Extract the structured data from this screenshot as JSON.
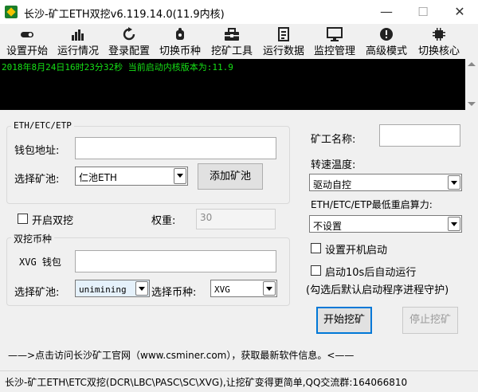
{
  "window": {
    "title": "长沙-矿工ETH双挖v6.119.14.0(11.9内核)",
    "minimize": "—",
    "maximize": "☐",
    "close": "✕"
  },
  "toolbar": {
    "items": [
      {
        "label": "设置开始",
        "icon": "toggle-icon"
      },
      {
        "label": "运行情况",
        "icon": "bar-chart-icon"
      },
      {
        "label": "登录配置",
        "icon": "refresh-icon"
      },
      {
        "label": "切换币种",
        "icon": "hand-icon"
      },
      {
        "label": "挖矿工具",
        "icon": "toolbox-icon"
      },
      {
        "label": "运行数据",
        "icon": "document-icon"
      },
      {
        "label": "监控管理",
        "icon": "monitor-icon"
      },
      {
        "label": "高级模式",
        "icon": "alert-icon"
      },
      {
        "label": "切换核心",
        "icon": "cpu-icon"
      }
    ]
  },
  "console": {
    "line": "2018年8月24日16时23分32秒 当前启动内核版本为:11.9"
  },
  "eth_group": {
    "title": "ETH/ETC/ETP",
    "wallet_label": "钱包地址:",
    "wallet_value": "",
    "pool_label": "选择矿池:",
    "pool_selected": "仁池ETH",
    "add_pool_button": "添加矿池"
  },
  "dual": {
    "enable_label": "开启双挖",
    "enable_checked": false,
    "weight_label": "权重:",
    "weight_value": "30"
  },
  "dual_group": {
    "title": "双挖币种",
    "wallet_label": "XVG 钱包",
    "wallet_value": "",
    "pool_label": "选择矿池:",
    "pool_selected": "unimining",
    "coin_label": "选择币种:",
    "coin_selected": "XVG"
  },
  "right": {
    "miner_name_label": "矿工名称:",
    "miner_name_value": "",
    "fan_temp_label": "转速温度:",
    "fan_temp_selected": "驱动自控",
    "restart_label": "ETH/ETC/ETP最低重启算力:",
    "restart_selected": "不设置",
    "autostart_label": "设置开机启动",
    "autostart_checked": false,
    "autorun_label": "启动10s后自动运行",
    "autorun_checked": false,
    "guard_note": "(勾选后默认启动程序进程守护)",
    "start_button": "开始挖矿",
    "stop_button": "停止挖矿"
  },
  "footer": {
    "info": "——>点击访问长沙矿工官网（www.csminer.com），获取最新软件信息。<——"
  },
  "statusbar": {
    "text": "长沙-矿工ETH\\ETC双挖(DCR\\LBC\\PASC\\SC\\XVG),让挖矿变得更简单,QQ交流群:164066810"
  }
}
